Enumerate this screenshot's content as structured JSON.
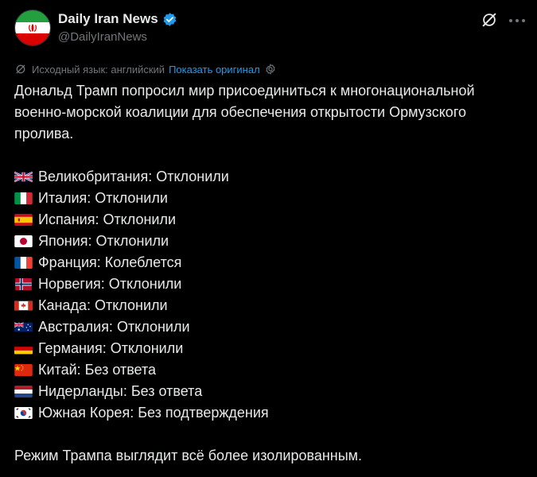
{
  "author": {
    "display_name": "Daily Iran News",
    "handle": "@DailyIranNews"
  },
  "translation": {
    "source_language": "Исходный язык: английский",
    "show_original": "Показать оригинал"
  },
  "tweet": {
    "intro": "Дональд Трамп попросил мир присоединиться к многонациональной военно-морской коалиции для обеспечения открытости Ормузского пролива.",
    "countries": [
      {
        "flag": "uk-flag",
        "text": "Великобритания: Отклонили"
      },
      {
        "flag": "italy-flag",
        "text": "Италия: Отклонили"
      },
      {
        "flag": "spain-flag",
        "text": "Испания: Отклонили"
      },
      {
        "flag": "japan-flag",
        "text": "Япония: Отклонили"
      },
      {
        "flag": "france-flag",
        "text": "Франция: Колеблется"
      },
      {
        "flag": "norway-flag",
        "text": "Норвегия: Отклонили"
      },
      {
        "flag": "canada-flag",
        "text": "Канада: Отклонили"
      },
      {
        "flag": "australia-flag",
        "text": "Австралия: Отклонили"
      },
      {
        "flag": "germany-flag",
        "text": "Германия: Отклонили"
      },
      {
        "flag": "china-flag",
        "text": "Китай: Без ответа"
      },
      {
        "flag": "netherlands-flag",
        "text": "Нидерланды: Без ответа"
      },
      {
        "flag": "south-korea-flag",
        "text": "Южная Корея: Без подтверждения"
      }
    ],
    "outro": "Режим Трампа выглядит всё более изолированным."
  },
  "icons": {
    "verified": "verified-badge-icon",
    "grok": "grok-icon",
    "more": "more-icon",
    "translate": "translate-icon",
    "settings": "gear-icon"
  },
  "colors": {
    "background": "#000000",
    "text": "#e7e9ea",
    "secondary": "#71767b",
    "accent": "#1d9bf0"
  }
}
